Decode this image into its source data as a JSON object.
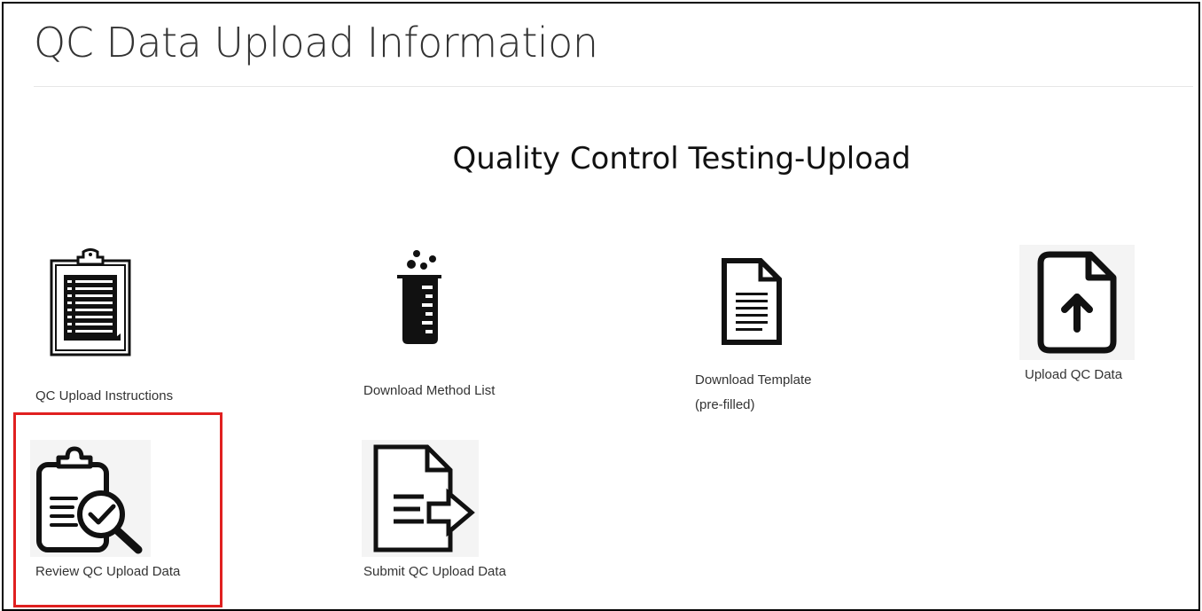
{
  "page": {
    "title": "QC Data Upload Information",
    "subtitle": "Quality Control Testing-Upload"
  },
  "tiles": [
    {
      "id": "qc-upload-instructions",
      "label": "QC Upload Instructions",
      "icon": "clipboard-list-icon"
    },
    {
      "id": "download-method-list",
      "label": "Download Method List",
      "icon": "beaker-icon"
    },
    {
      "id": "download-template",
      "label_line1": "Download Template",
      "label_line2": "(pre-filled)",
      "icon": "document-lines-icon"
    },
    {
      "id": "upload-qc-data",
      "label": "Upload QC Data",
      "icon": "file-upload-icon"
    },
    {
      "id": "review-qc-upload-data",
      "label": "Review QC Upload Data",
      "icon": "clipboard-check-magnifier-icon"
    },
    {
      "id": "submit-qc-upload-data",
      "label": "Submit QC Upload Data",
      "icon": "document-arrow-right-icon"
    }
  ],
  "colors": {
    "highlight": "#e02020",
    "text": "#333333",
    "icon": "#111111",
    "icon_background": "#f4f4f4"
  }
}
